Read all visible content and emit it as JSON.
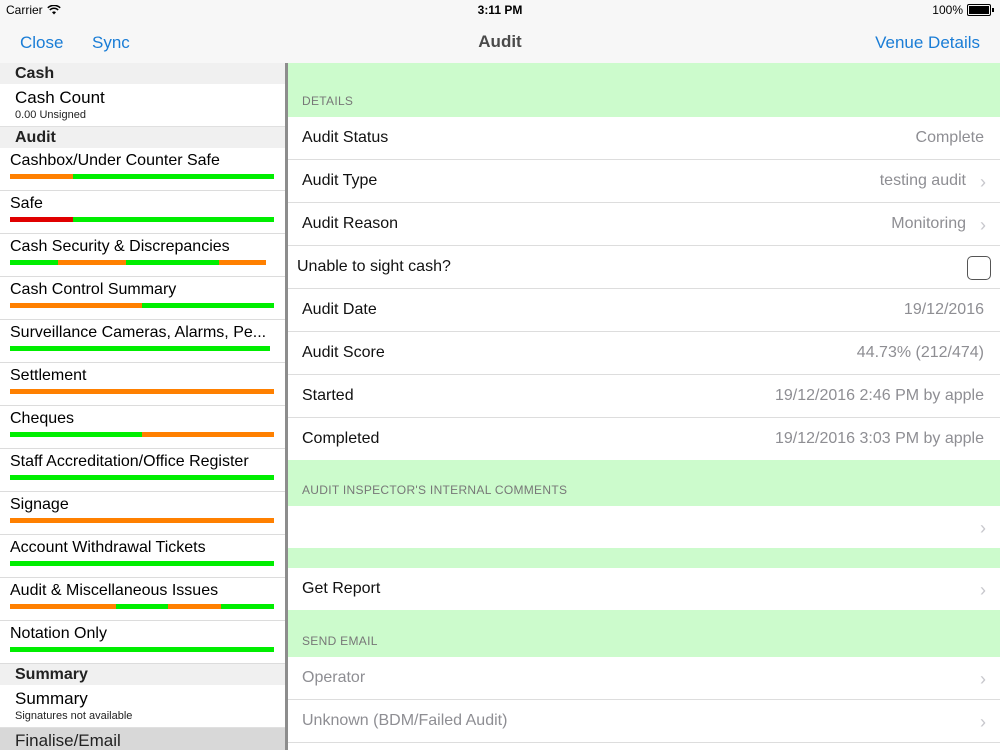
{
  "status_bar": {
    "carrier": "Carrier",
    "time": "3:11 PM",
    "battery": "100%"
  },
  "navbar": {
    "close": "Close",
    "sync": "Sync",
    "title": "Audit",
    "venue_details": "Venue Details"
  },
  "sidebar": {
    "cash_header": "Cash",
    "cash_count": {
      "title": "Cash Count",
      "subtitle": "0.00 Unsigned"
    },
    "audit_header": "Audit",
    "audit_items": [
      {
        "label": "Cashbox/Under Counter Safe",
        "segments": [
          {
            "color": "#ff8000",
            "frac": 0.24
          },
          {
            "color": "#00ee00",
            "frac": 0.76
          }
        ]
      },
      {
        "label": "Safe",
        "segments": [
          {
            "color": "#e00000",
            "frac": 0.24
          },
          {
            "color": "#00ee00",
            "frac": 0.76
          }
        ]
      },
      {
        "label": "Cash Security & Discrepancies",
        "segments": [
          {
            "color": "#00ee00",
            "frac": 0.18
          },
          {
            "color": "#ff8000",
            "frac": 0.26
          },
          {
            "color": "#00ee00",
            "frac": 0.35
          },
          {
            "color": "#ff8000",
            "frac": 0.18
          }
        ]
      },
      {
        "label": "Cash Control Summary",
        "segments": [
          {
            "color": "#ff8000",
            "frac": 0.5
          },
          {
            "color": "#00ee00",
            "frac": 0.5
          }
        ]
      },
      {
        "label": "Surveillance Cameras, Alarms, Pe...",
        "segments": [
          {
            "color": "#00ee00",
            "frac": 0.985
          }
        ]
      },
      {
        "label": "Settlement",
        "segments": [
          {
            "color": "#ff8000",
            "frac": 1.0
          }
        ]
      },
      {
        "label": "Cheques",
        "segments": [
          {
            "color": "#00ee00",
            "frac": 0.5
          },
          {
            "color": "#ff8000",
            "frac": 0.5
          }
        ]
      },
      {
        "label": "Staff Accreditation/Office Register",
        "segments": [
          {
            "color": "#00ee00",
            "frac": 1.0
          }
        ]
      },
      {
        "label": "Signage",
        "segments": [
          {
            "color": "#ff8000",
            "frac": 1.0
          }
        ]
      },
      {
        "label": "Account Withdrawal Tickets",
        "segments": [
          {
            "color": "#00ee00",
            "frac": 1.0
          }
        ]
      },
      {
        "label": "Audit & Miscellaneous Issues",
        "segments": [
          {
            "color": "#ff8000",
            "frac": 0.4
          },
          {
            "color": "#00ee00",
            "frac": 0.2
          },
          {
            "color": "#ff8000",
            "frac": 0.2
          },
          {
            "color": "#00ee00",
            "frac": 0.2
          }
        ]
      },
      {
        "label": "Notation Only",
        "segments": [
          {
            "color": "#00ee00",
            "frac": 1.0
          }
        ]
      }
    ],
    "summary_header": "Summary",
    "summary": {
      "title": "Summary",
      "subtitle": "Signatures not available"
    },
    "finalise": "Finalise/Email"
  },
  "main": {
    "details_header": "DETAILS",
    "rows": {
      "status": {
        "label": "Audit Status",
        "value": "Complete"
      },
      "type": {
        "label": "Audit Type",
        "value": "testing audit"
      },
      "reason": {
        "label": "Audit Reason",
        "value": "Monitoring"
      },
      "unable": {
        "label": "Unable to sight cash?"
      },
      "date": {
        "label": "Audit Date",
        "value": "19/12/2016"
      },
      "score": {
        "label": "Audit Score",
        "value": "44.73% (212/474)"
      },
      "started": {
        "label": "Started",
        "value": "19/12/2016 2:46 PM by apple"
      },
      "completed": {
        "label": "Completed",
        "value": "19/12/2016 3:03 PM by apple"
      }
    },
    "comments_header": "AUDIT INSPECTOR'S INTERNAL COMMENTS",
    "comments_value": "",
    "get_report": "Get Report",
    "send_email_header": "SEND EMAIL",
    "email_rows": [
      "Operator",
      "Unknown (BDM/Failed Audit)"
    ],
    "colors": {
      "accent": "#1a7dd6",
      "section_green": "#ccfbcc"
    }
  }
}
